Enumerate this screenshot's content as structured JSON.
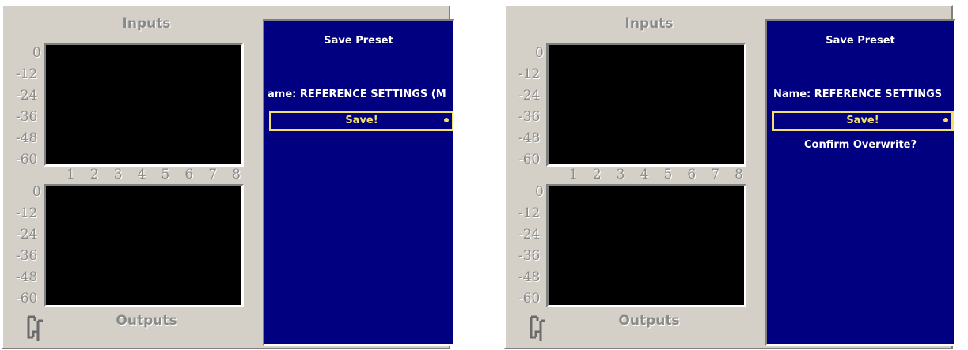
{
  "panels": [
    {
      "inputs_label": "Inputs",
      "outputs_label": "Outputs",
      "input_scale": [
        "0",
        "-12",
        "-24",
        "-36",
        "-48",
        "-60"
      ],
      "output_scale": [
        "0",
        "-12",
        "-24",
        "-36",
        "-48",
        "-60"
      ],
      "channels": [
        "1",
        "2",
        "3",
        "4",
        "5",
        "6",
        "7",
        "8"
      ],
      "display": {
        "title": "Save Preset",
        "name_line": "ame: REFERENCE SETTINGS (M",
        "save_label": "Save!",
        "confirm_text": ""
      }
    },
    {
      "inputs_label": "Inputs",
      "outputs_label": "Outputs",
      "input_scale": [
        "0",
        "-12",
        "-24",
        "-36",
        "-48",
        "-60"
      ],
      "output_scale": [
        "0",
        "-12",
        "-24",
        "-36",
        "-48",
        "-60"
      ],
      "channels": [
        "1",
        "2",
        "3",
        "4",
        "5",
        "6",
        "7",
        "8"
      ],
      "display": {
        "title": "Save Preset",
        "name_line": "Name: REFERENCE SETTINGS",
        "save_label": "Save!",
        "confirm_text": "Confirm Overwrite?"
      }
    }
  ],
  "icons": {
    "logo": "company-logo-icon",
    "indicator": "selection-dot-icon"
  },
  "colors": {
    "panel": "#d4d0c8",
    "display": "#000080",
    "highlight": "#f2e06b",
    "meter": "#000000"
  }
}
